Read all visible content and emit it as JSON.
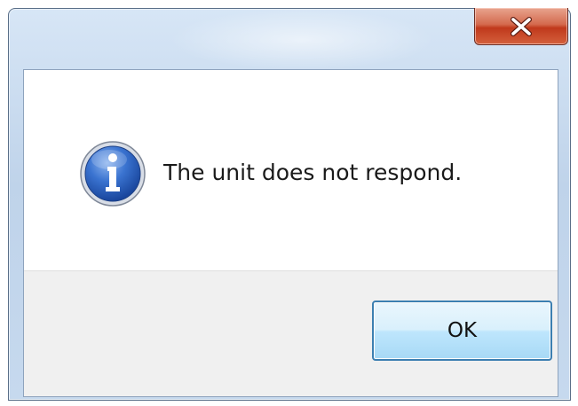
{
  "dialog": {
    "close_icon": "close-x-icon",
    "message_icon": "information-icon",
    "message": "The unit does not respond.",
    "ok_label": "OK"
  },
  "colors": {
    "close_button": "#c7432a",
    "ok_border": "#3c7fb1",
    "info_icon_blue": "#2b62c2",
    "button_area_bg": "#f0f0f0"
  }
}
